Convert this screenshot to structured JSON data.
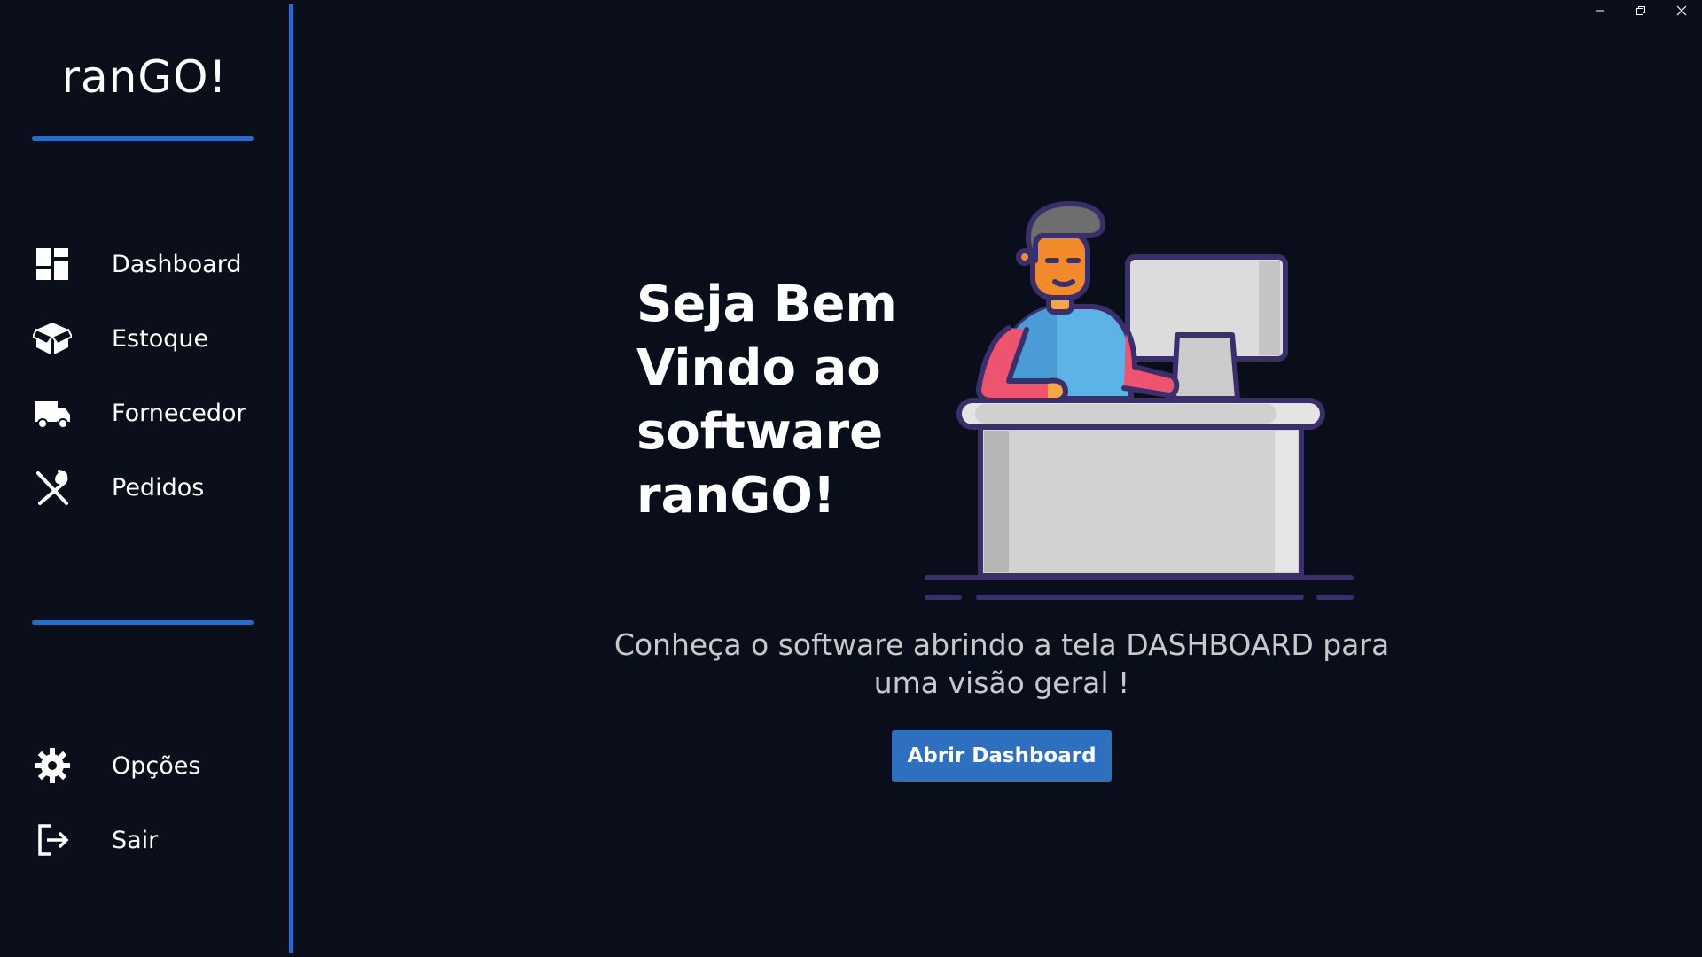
{
  "app": {
    "logo_text": "ranGO!"
  },
  "window_controls": {
    "minimize_icon": "minimize-icon",
    "restore_icon": "restore-icon",
    "close_icon": "close-icon"
  },
  "sidebar": {
    "nav_items": [
      {
        "label": "Dashboard",
        "icon": "dashboard-icon"
      },
      {
        "label": "Estoque",
        "icon": "box-icon"
      },
      {
        "label": "Fornecedor",
        "icon": "truck-icon"
      },
      {
        "label": "Pedidos",
        "icon": "utensils-icon"
      }
    ],
    "bottom_items": [
      {
        "label": "Opções",
        "icon": "gear-icon"
      },
      {
        "label": "Sair",
        "icon": "logout-icon"
      }
    ]
  },
  "main": {
    "welcome_line1": "Seja Bem",
    "welcome_line2": "Vindo ao",
    "welcome_line3": "software",
    "welcome_line4": "ranGO!",
    "subtitle_line1": "Conheça o software abrindo a tela DASHBOARD para",
    "subtitle_line2": "uma visão geral !",
    "button_label": "Abrir Dashboard"
  },
  "colors": {
    "background": "#0a0d1a",
    "accent": "#2b6bc4",
    "button": "#2e6fc0"
  }
}
